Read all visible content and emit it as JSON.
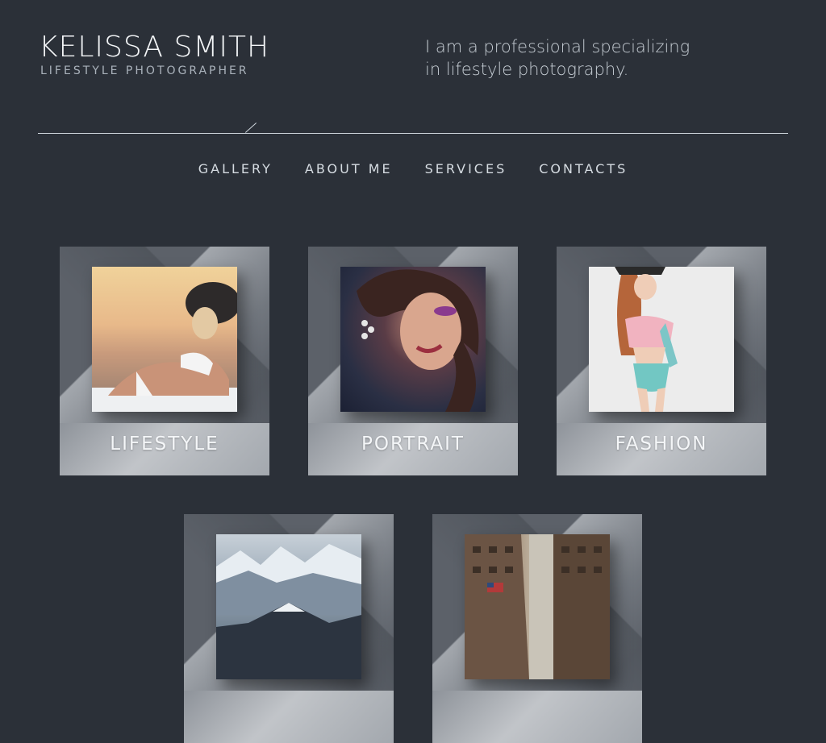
{
  "header": {
    "name": "KELISSA SMITH",
    "subtitle": "LIFESTYLE PHOTOGRAPHER",
    "tagline_line1": "I am a professional specializing",
    "tagline_line2": "in lifestyle photography."
  },
  "nav": {
    "items": [
      "GALLERY",
      "ABOUT ME",
      "SERVICES",
      "CONTACTS"
    ]
  },
  "gallery": {
    "cards": [
      {
        "label": "LIFESTYLE"
      },
      {
        "label": "PORTRAIT"
      },
      {
        "label": "FASHION"
      },
      {
        "label": ""
      },
      {
        "label": ""
      }
    ]
  },
  "colors": {
    "background": "#2b3038",
    "card": "#5c6169"
  }
}
